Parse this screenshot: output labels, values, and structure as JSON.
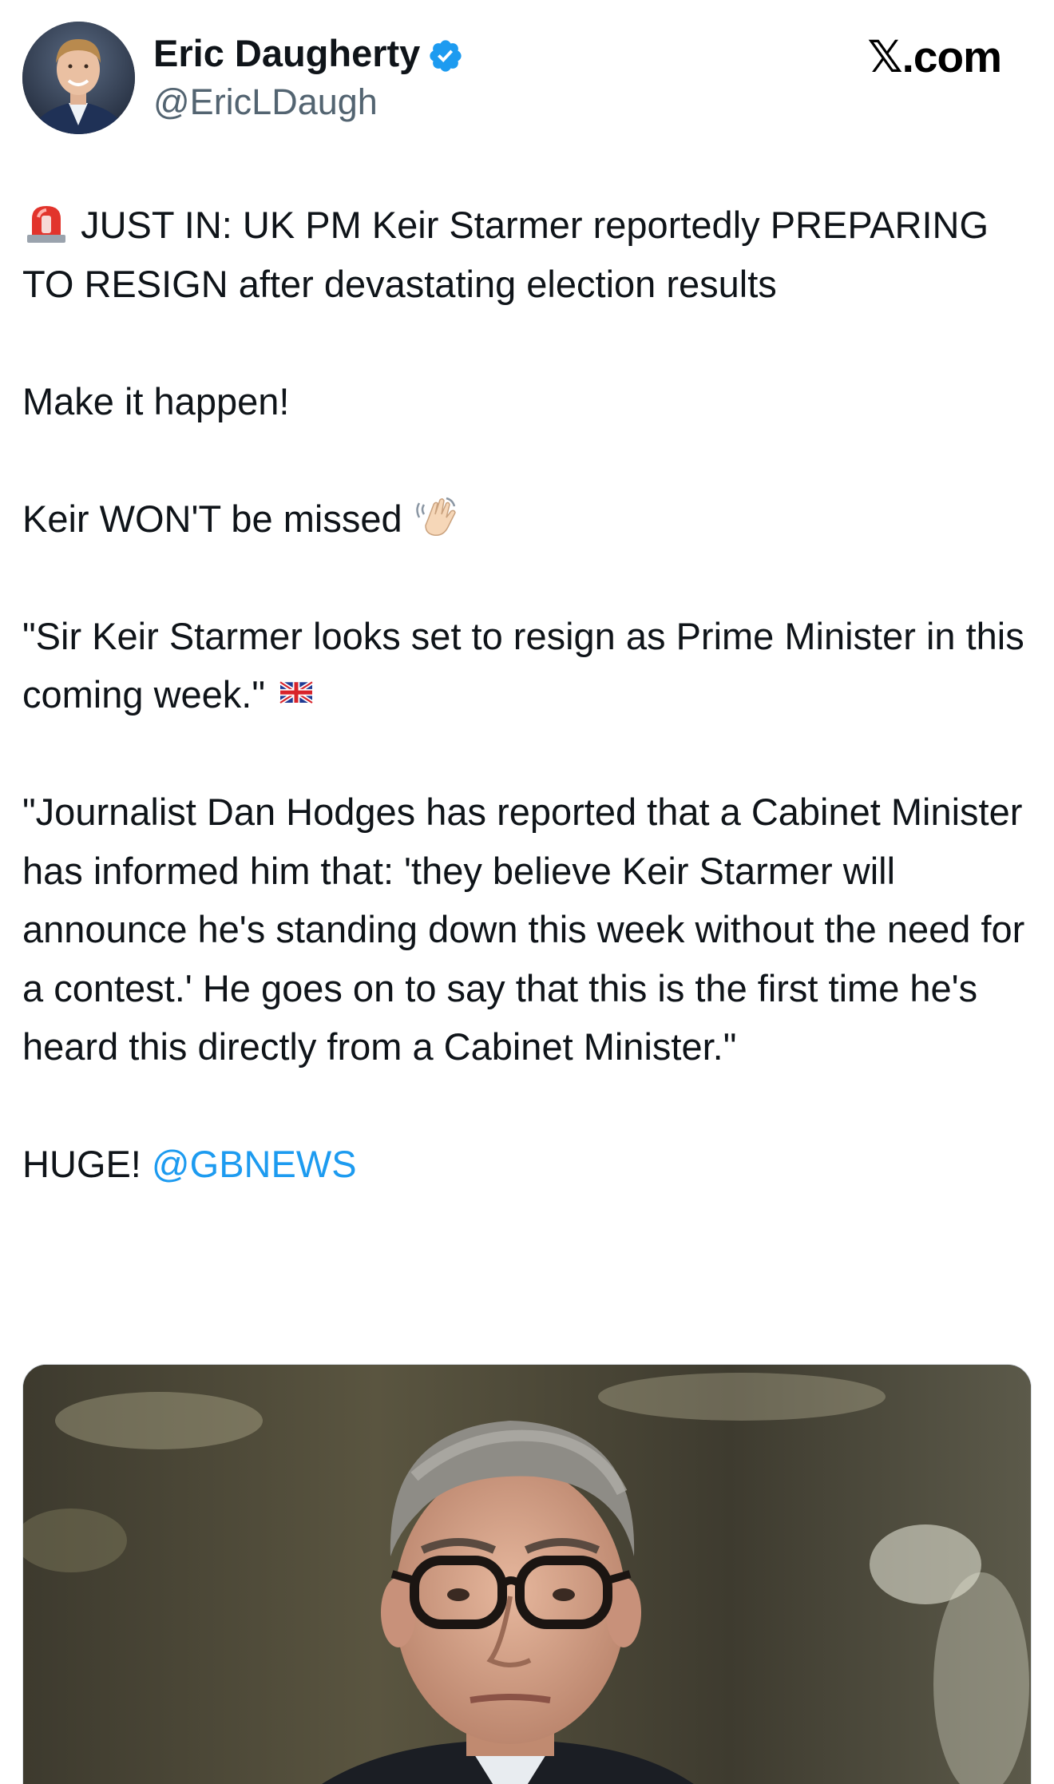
{
  "author": {
    "name": "Eric Daugherty",
    "handle": "@EricLDaugh",
    "verified": true,
    "avatar_icon": "avatar-photo"
  },
  "source": {
    "label": "𝕏.com"
  },
  "tweet": {
    "line1_text": "JUST IN: UK PM Keir Starmer reportedly PREPARING TO RESIGN after devastating election results",
    "line1_emoji": "rotating-light-icon",
    "line2_text": "Make it happen!",
    "line3_text": "Keir WON'T be missed",
    "line3_emoji": "waving-hand-icon",
    "line4_text": "\"Sir Keir Starmer looks set to resign as Prime Minister in this coming week.\"",
    "line4_emoji": "uk-flag-icon",
    "line5_text": "\"Journalist Dan Hodges has reported that a Cabinet Minister has informed him that: 'they believe Keir Starmer will announce he's standing down this week without the need for a contest.' He goes on to say that this is the first time he's heard this directly from a Cabinet Minister.\"",
    "line6_text": "HUGE!",
    "line6_mention": "@GBNEWS"
  },
  "media": {
    "type": "photo",
    "subject": "portrait"
  },
  "colors": {
    "text": "#0f1419",
    "handle": "#536471",
    "mention": "#1d9bf0",
    "verified": "#1d9bf0"
  }
}
